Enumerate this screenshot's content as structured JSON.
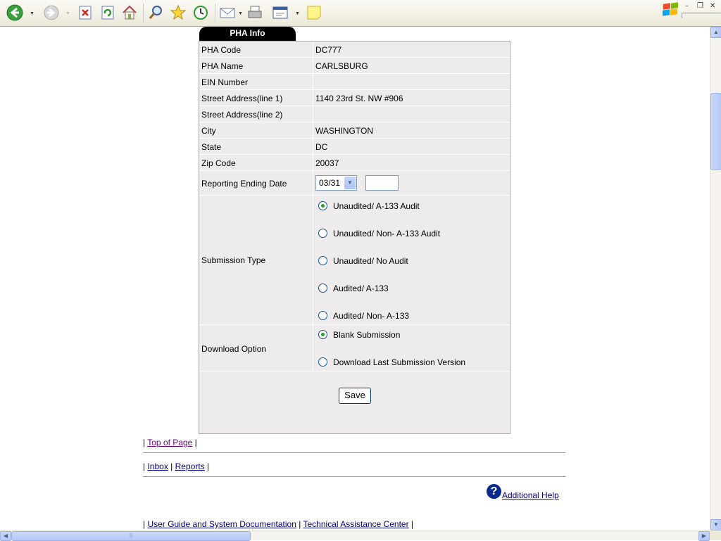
{
  "toolbar": {
    "icons": [
      "back-icon",
      "forward-icon",
      "stop-icon",
      "refresh-icon",
      "home-icon",
      "search-icon",
      "favorites-icon",
      "history-icon",
      "mail-icon",
      "print-icon",
      "edit-icon",
      "note-icon"
    ]
  },
  "tab_title": "PHA Info",
  "fields": [
    {
      "label": "PHA Code",
      "value": "DC777"
    },
    {
      "label": "PHA Name",
      "value": "CARLSBURG"
    },
    {
      "label": "EIN Number",
      "value": ""
    },
    {
      "label": "Street Address(line 1)",
      "value": "1140 23rd St. NW #906"
    },
    {
      "label": "Street Address(line 2)",
      "value": ""
    },
    {
      "label": "City",
      "value": "WASHINGTON"
    },
    {
      "label": "State",
      "value": "DC"
    },
    {
      "label": "Zip Code",
      "value": "20037"
    }
  ],
  "reporting": {
    "label": "Reporting Ending Date",
    "selected": "03/31",
    "year_value": ""
  },
  "submission": {
    "label": "Submission Type",
    "options": [
      {
        "label": "Unaudited/ A-133 Audit",
        "checked": true
      },
      {
        "label": "Unaudited/ Non- A-133 Audit",
        "checked": false
      },
      {
        "label": "Unaudited/ No Audit",
        "checked": false
      },
      {
        "label": "Audited/ A-133",
        "checked": false
      },
      {
        "label": "Audited/ Non- A-133",
        "checked": false
      }
    ]
  },
  "download": {
    "label": "Download Option",
    "options": [
      {
        "label": "Blank Submission",
        "checked": true
      },
      {
        "label": "Download Last Submission Version",
        "checked": false
      }
    ]
  },
  "save_label": "Save",
  "links": {
    "top_of_page": "Top of Page",
    "inbox": "Inbox",
    "reports": "Reports",
    "additional_help": "Additional Help",
    "user_guide": "User Guide and System Documentation",
    "tac": "Technical Assistance Center",
    "separator": "|"
  },
  "colors": {
    "panel_bg": "#edebeb",
    "tab_bg": "#000000",
    "link": "#00007f",
    "visited_link": "#6b007f"
  }
}
